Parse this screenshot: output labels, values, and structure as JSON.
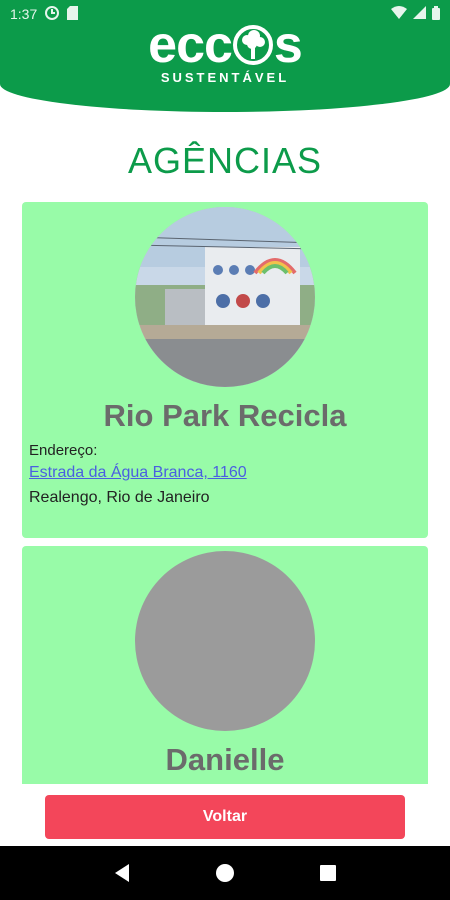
{
  "status_bar": {
    "time": "1:37",
    "icons": [
      "data-saver-icon",
      "sd-card-icon",
      "wifi-icon",
      "signal-icon",
      "battery-icon"
    ]
  },
  "header": {
    "logo_text_left": "ecc",
    "logo_text_right": "s",
    "logo_subtitle": "SUSTENTÁVEL",
    "brand_color": "#0c9b4a"
  },
  "page": {
    "title": "AGÊNCIAS"
  },
  "agencies": [
    {
      "name": "Rio Park Recicla",
      "address_label": "Endereço:",
      "address": "Estrada da Água Branca, 1160",
      "city": "Realengo, Rio de Janeiro",
      "photo": "building-photo"
    },
    {
      "name": "Danielle",
      "photo": "placeholder-photo"
    }
  ],
  "actions": {
    "back_label": "Voltar"
  },
  "colors": {
    "card_background": "#98fba8",
    "button": "#f3465a",
    "link": "#4a5fe0"
  }
}
